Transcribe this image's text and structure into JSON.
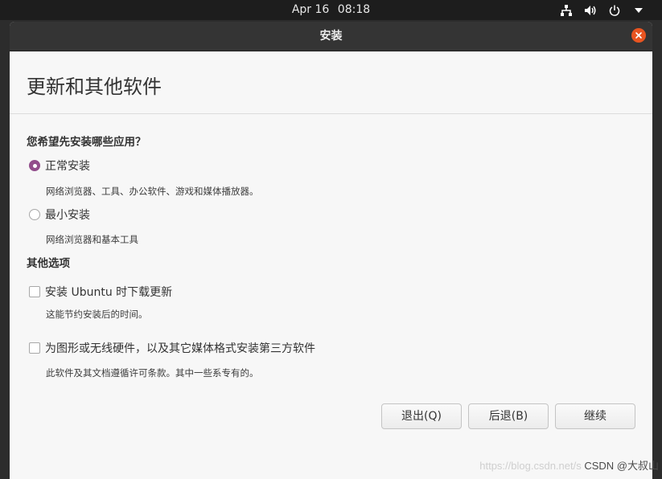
{
  "topbar": {
    "date": "Apr 16",
    "time": "08:18",
    "icons": [
      "network-icon",
      "volume-icon",
      "power-icon",
      "caret-down-icon"
    ]
  },
  "window": {
    "title": "安装",
    "close_icon": "close-icon",
    "accent_color": "#e95420"
  },
  "page": {
    "title": "更新和其他软件"
  },
  "install_type": {
    "question": "您希望先安装哪些应用？",
    "options": [
      {
        "label": "正常安装",
        "description": "网络浏览器、工具、办公软件、游戏和媒体播放器。",
        "selected": true
      },
      {
        "label": "最小安装",
        "description": "网络浏览器和基本工具",
        "selected": false
      }
    ],
    "radio_color": "#924d8b"
  },
  "other_options": {
    "heading": "其他选项",
    "items": [
      {
        "label": "安装 Ubuntu 时下载更新",
        "description": "这能节约安装后的时间。",
        "checked": false
      },
      {
        "label": "为图形或无线硬件，以及其它媒体格式安装第三方软件",
        "description": "此软件及其文档遵循许可条款。其中一些系专有的。",
        "checked": false
      }
    ]
  },
  "buttons": {
    "quit": "退出(Q)",
    "back": "后退(B)",
    "continue": "继续"
  },
  "watermark": {
    "url": "https://blog.csdn.net/s",
    "author": "CSDN @大叔山"
  }
}
